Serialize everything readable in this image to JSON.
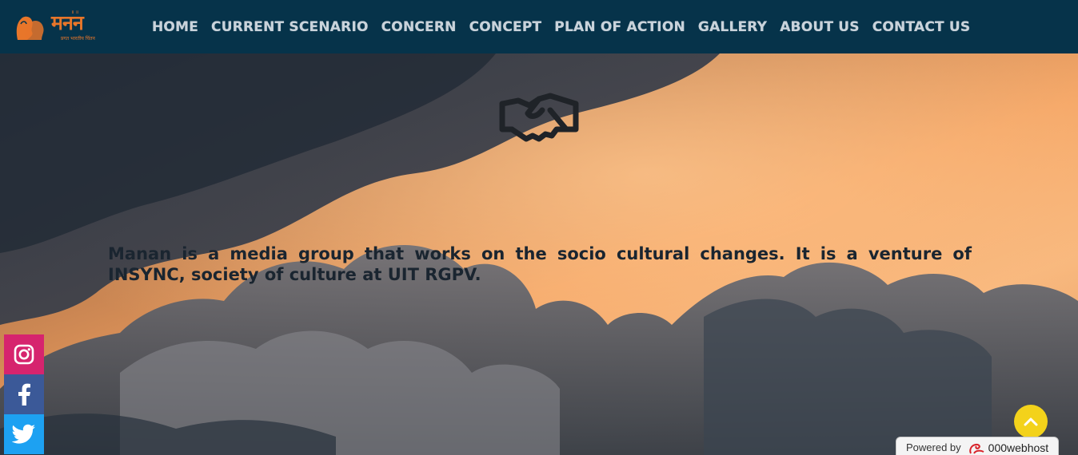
{
  "logo": {
    "title": "मनन",
    "tagline": "प्रगत भारतीय चिंतन",
    "top_mark": "॥ ॥"
  },
  "nav": {
    "items": [
      {
        "label": "HOME"
      },
      {
        "label": "CURRENT SCENARIO"
      },
      {
        "label": "CONCERN"
      },
      {
        "label": "CONCEPT"
      },
      {
        "label": "PLAN OF ACTION"
      },
      {
        "label": "GALLERY"
      },
      {
        "label": "ABOUT US"
      },
      {
        "label": "CONTACT US"
      }
    ]
  },
  "hero": {
    "icon": "handshake-icon",
    "text": "Manan is a media group that works on the socio cultural changes. It is a venture of INSYNC, society of culture at UIT RGPV."
  },
  "social": {
    "items": [
      {
        "icon": "instagram-icon",
        "color": "#d6246e"
      },
      {
        "icon": "facebook-icon",
        "color": "#3b5998"
      },
      {
        "icon": "twitter-icon",
        "color": "#1da1f2"
      }
    ]
  },
  "back_to_top": {
    "icon": "chevron-up-icon",
    "color": "#f3d21b"
  },
  "powered_by": {
    "label": "Powered by",
    "brand": "000webhost"
  },
  "colors": {
    "navbar": "#06334a",
    "nav_text": "#c9d3db",
    "logo": "#e8762a",
    "hero_text": "#1a2530"
  }
}
